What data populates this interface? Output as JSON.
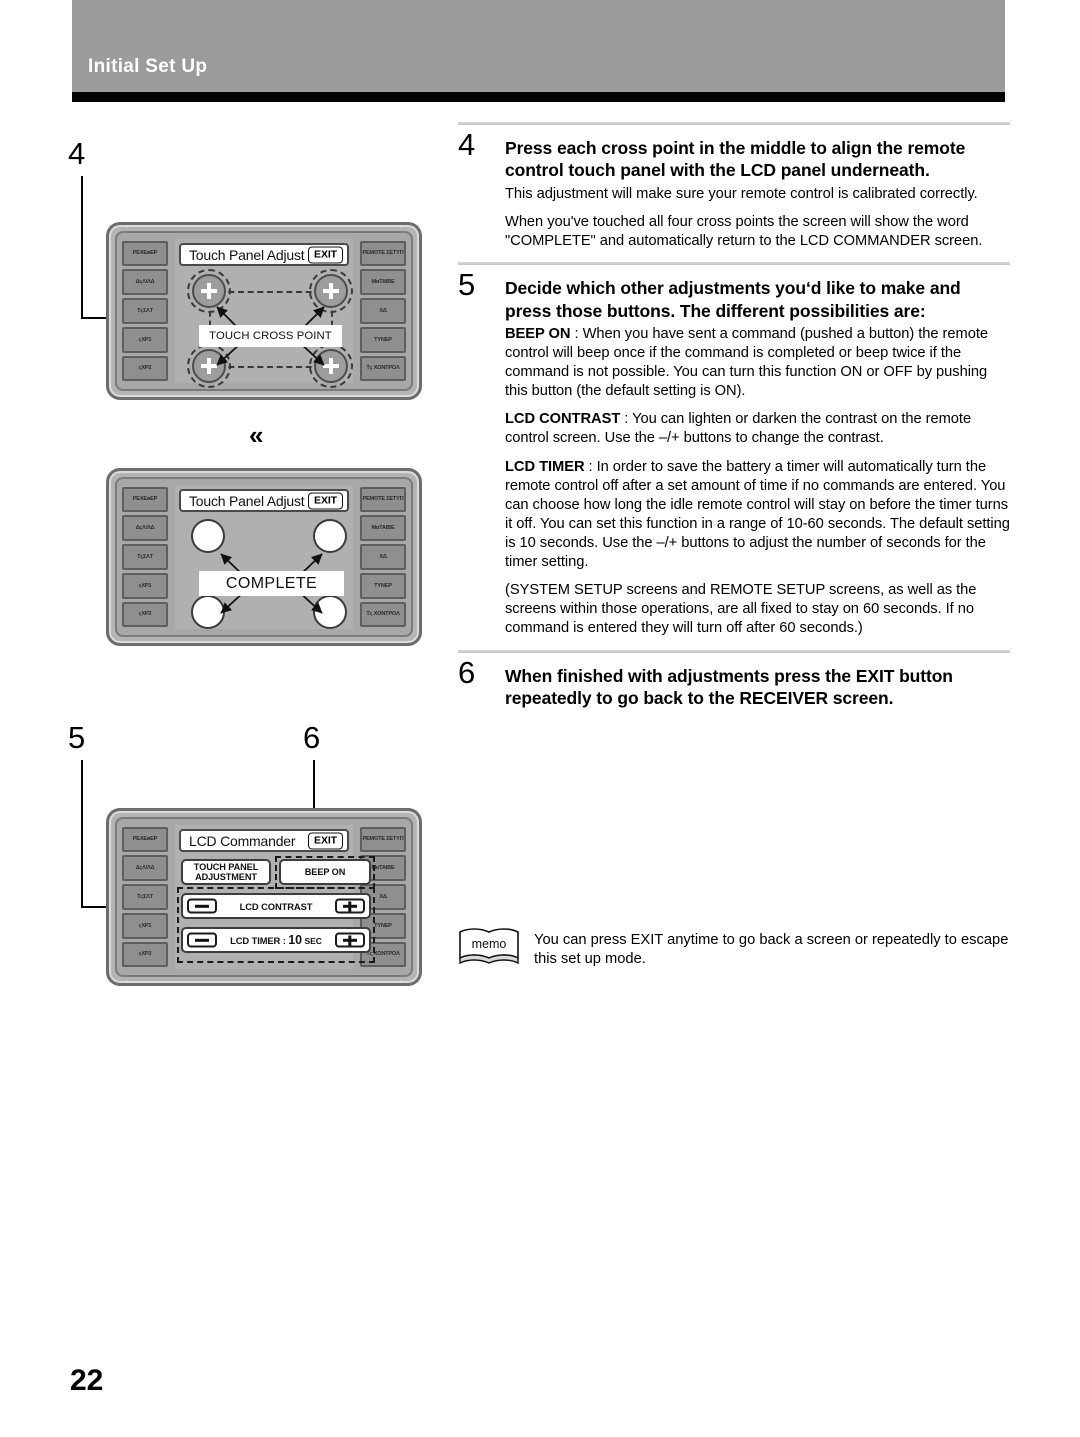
{
  "header": {
    "title": "Initial Set Up"
  },
  "page_number": "22",
  "transition_marker": "«",
  "steps": [
    {
      "number": "4",
      "heading": "Press each cross point in the middle to align the remote  control touch panel with the LCD panel underneath.",
      "paragraphs": [
        "This adjustment will make sure your remote control is calibrated correctly.",
        "When you've touched all four cross points the screen will show the word \"COMPLETE\" and automatically return to the LCD COMMANDER screen."
      ]
    },
    {
      "number": "5",
      "heading": "Decide which other adjustments you‘d like to make and press those buttons. The different possibilities are:",
      "definitions": [
        {
          "term": "BEEP ON",
          "text": " : When you have sent a command (pushed a button) the remote control will beep once if the command is completed or beep twice if the command is not possible. You can turn this function ON or OFF by pushing this button (the default setting is ON)."
        },
        {
          "term": "LCD CONTRAST",
          "text": " : You can lighten or darken the contrast on the remote control screen. Use the –/+ buttons to change the contrast."
        },
        {
          "term": "LCD TIMER",
          "text": " : In order to save the battery a timer will automatically turn the remote control off after a set amount of time if no commands are entered. You can choose how long the idle remote control will stay on before the timer turns it off. You can set this function in a range of 10-60 seconds. The default setting is 10 seconds. Use the –/+ buttons to adjust the number of seconds for the timer setting."
        }
      ],
      "note": "(SYSTEM SETUP screens and REMOTE SETUP screens, as well as the screens within those operations, are all fixed to stay on 60 seconds. If no command is entered they will turn off after 60 seconds.)"
    },
    {
      "number": "6",
      "heading": "When finished with adjustments press the EXIT button repeatedly to go back to the RECEIVER screen."
    }
  ],
  "memo": {
    "label": "memo",
    "text": "You can press EXIT anytime to go back a screen or repeatedly to escape this set up mode."
  },
  "callouts": {
    "four": "4",
    "five": "5",
    "six": "6"
  },
  "device_side_buttons": {
    "left": [
      "РEXEʙЕР",
      "ΔςΛ/ΛΔ",
      "TςΣΛT",
      "ςXP1",
      "ςXP2"
    ],
    "right": [
      "PEMOTE ΣETYΠ",
      "MαTAΙΒΕ",
      "XΔ",
      "TYNEP",
      "Tς XONTPOΛ"
    ]
  },
  "figure_cross": {
    "title": "Touch Panel Adjust",
    "exit": "EXIT",
    "center_label": "TOUCH CROSS POINT"
  },
  "figure_complete": {
    "title": "Touch Panel Adjust",
    "exit": "EXIT",
    "center_label": "COMPLETE"
  },
  "figure_commander": {
    "title": "LCD Commander",
    "exit": "EXIT",
    "touch_panel_line1": "TOUCH PANEL",
    "touch_panel_line2": "ADJUSTMENT",
    "beep": "BEEP ON",
    "contrast": "LCD CONTRAST",
    "timer_label": "LCD TIMER :",
    "timer_value": "10",
    "timer_unit": "SEC"
  }
}
